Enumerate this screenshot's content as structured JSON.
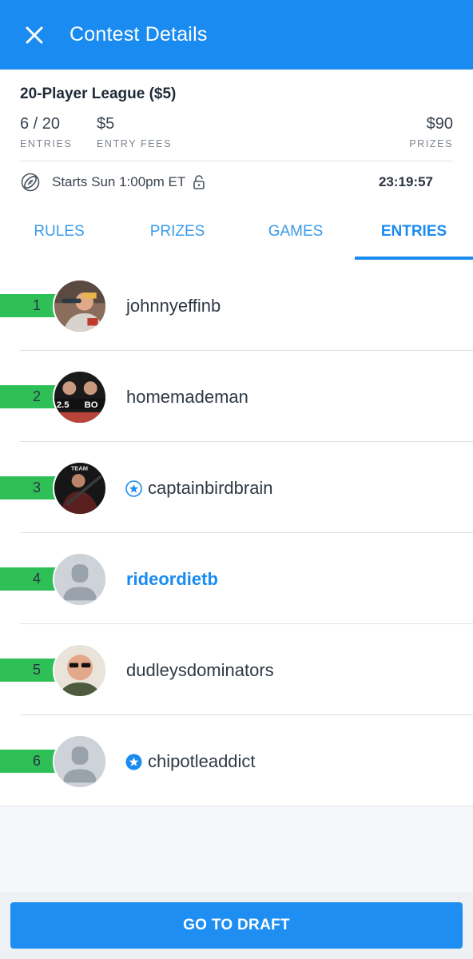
{
  "header": {
    "title": "Contest Details",
    "close_icon": "close-icon"
  },
  "contest": {
    "name": "20-Player League ($5)",
    "entries_value": "6 / 20",
    "entries_label": "ENTRIES",
    "fees_value": "$5",
    "fees_label": "ENTRY FEES",
    "prizes_value": "$90",
    "prizes_label": "PRIZES",
    "start_text": "Starts Sun 1:00pm ET",
    "countdown": "23:19:57"
  },
  "tabs": [
    {
      "label": "RULES",
      "active": false
    },
    {
      "label": "PRIZES",
      "active": false
    },
    {
      "label": "GAMES",
      "active": false
    },
    {
      "label": "ENTRIES",
      "active": true
    }
  ],
  "entries": [
    {
      "rank": "1",
      "username": "johnnyeffinb",
      "badge": false,
      "is_me": false,
      "avatar": "photo"
    },
    {
      "rank": "2",
      "username": "homemademan",
      "badge": false,
      "is_me": false,
      "avatar": "photo"
    },
    {
      "rank": "3",
      "username": "captainbirdbrain",
      "badge": true,
      "is_me": false,
      "avatar": "photo"
    },
    {
      "rank": "4",
      "username": "rideordietb",
      "badge": false,
      "is_me": true,
      "avatar": "default"
    },
    {
      "rank": "5",
      "username": "dudleysdominators",
      "badge": false,
      "is_me": false,
      "avatar": "photo"
    },
    {
      "rank": "6",
      "username": "chipotleaddict",
      "badge": true,
      "is_me": false,
      "avatar": "default"
    }
  ],
  "footer": {
    "button_label": "GO TO DRAFT"
  },
  "colors": {
    "brand_blue": "#1a8bf0",
    "rank_green": "#2fbf57",
    "divider": "#dde1e6"
  }
}
